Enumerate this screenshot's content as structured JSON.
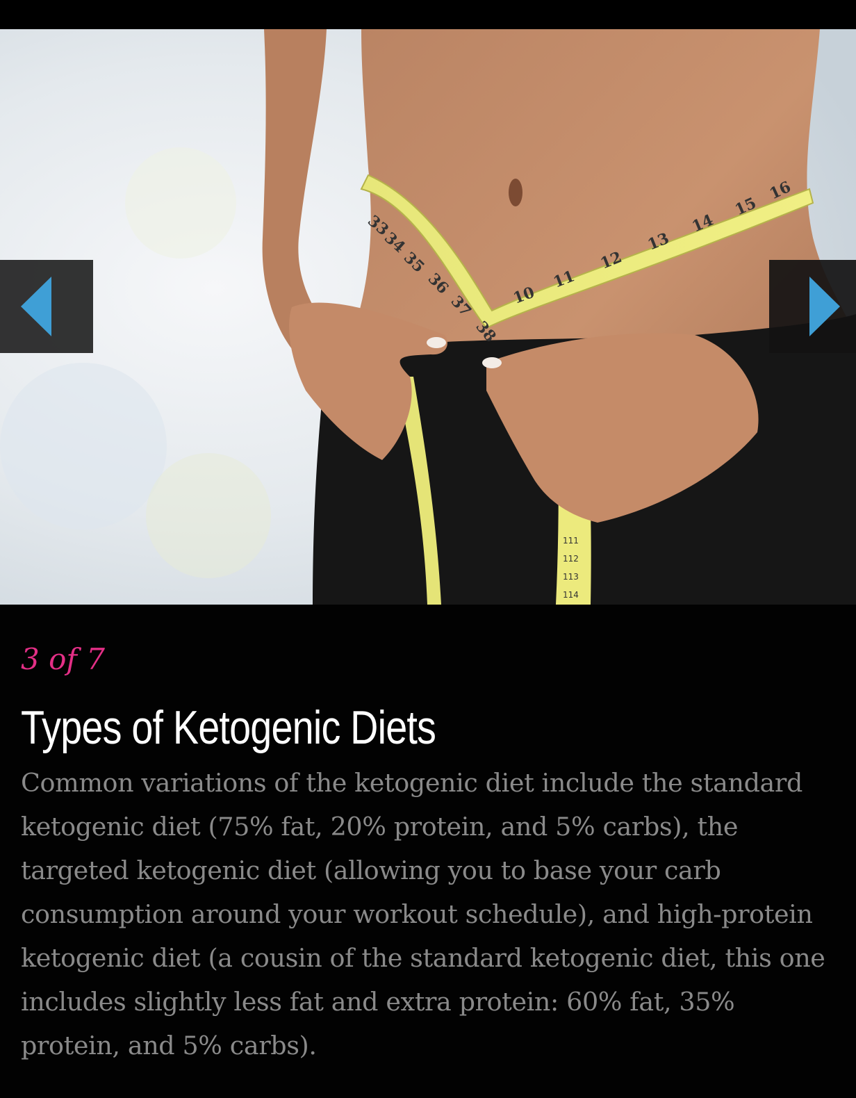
{
  "slideshow": {
    "image_alt": "woman measuring waist with yellow measuring tape",
    "counter": "3 of 7",
    "title": "Types of Ketogenic Diets",
    "description": "Common variations of the ketogenic diet include the standard ketogenic diet (75% fat, 20% protein, and 5% carbs), the targeted ketogenic diet (allowing you to base your carb consumption around your workout schedule), and high-protein ketogenic diet (a cousin of the standard ketogenic diet, this one includes slightly less fat and extra protein: 60% fat, 35% protein, and 5% carbs).",
    "prev_icon": "triangle-left-icon",
    "next_icon": "triangle-right-icon",
    "tape_numbers": [
      "33",
      "34",
      "35",
      "36",
      "37",
      "38",
      "10",
      "11",
      "12",
      "13",
      "14",
      "15",
      "16",
      "111",
      "112",
      "113",
      "114"
    ]
  },
  "colors": {
    "background": "#020202",
    "counter": "#e32f86",
    "title": "#ffffff",
    "body": "#8a8a8a",
    "arrow": "#3f9fd6",
    "arrow_box": "#181818"
  }
}
